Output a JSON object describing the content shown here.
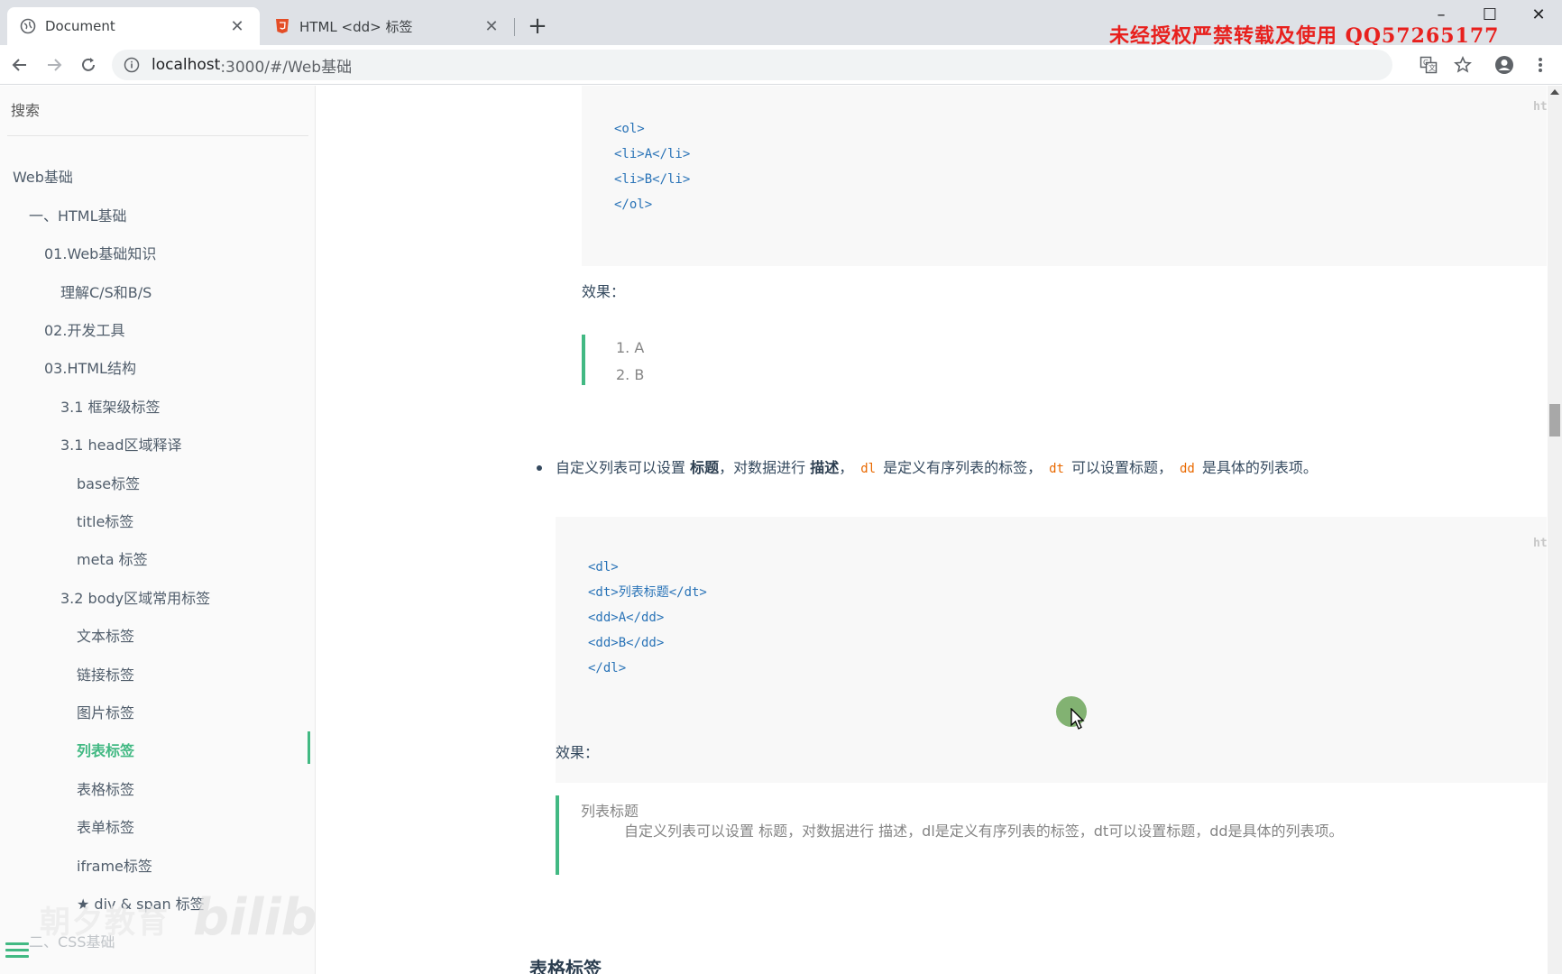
{
  "browser": {
    "tabs": [
      {
        "title": "Document",
        "active": true
      },
      {
        "title": "HTML <dd> 标签",
        "active": false
      }
    ],
    "url_host": "localhost",
    "url_path": ":3000/#/Web基础",
    "watermark": "未经授权严禁转载及使用 QQ57265177"
  },
  "sidebar": {
    "search_placeholder": "搜索",
    "items": [
      "Web基础",
      "一、HTML基础",
      "01.Web基础知识",
      "理解C/S和B/S",
      "02.开发工具",
      "03.HTML结构",
      "3.1 框架级标签",
      "3.1 head区域释译",
      "base标签",
      "title标签",
      "meta 标签",
      "3.2 body区域常用标签",
      "文本标签",
      "链接标签",
      "图片标签",
      "列表标签",
      "表格标签",
      "表单标签",
      "iframe标签",
      "★ div & span 标签",
      "二、CSS基础"
    ],
    "active_item": "列表标签",
    "brand_watermark": "朝夕教育",
    "site_watermark": "bilibili"
  },
  "content": {
    "code1": {
      "lang": "html",
      "lines": [
        "<ol>",
        "<li>A</li>",
        "<li>B</li>",
        "</ol>"
      ]
    },
    "effect_label_1": "效果：",
    "ol_items": [
      "1. A",
      "2. B"
    ],
    "bullet_text_parts": {
      "p1": "自定义列表可以设置 ",
      "b1": "标题",
      "p2": "，对数据进行 ",
      "b2": "描述",
      "p3": "，",
      "c1": "dl",
      "p4": "是定义有序列表的标签，",
      "c2": "dt",
      "p5": "可以设置标题，",
      "c3": "dd",
      "p6": "是具体的列表项。"
    },
    "code2": {
      "lang": "html",
      "lines": [
        "<dl>",
        "<dt>列表标题</dt>",
        "<dd>A</dd>",
        "<dd>B</dd>",
        "</dl>"
      ]
    },
    "effect_label_2": "效果：",
    "dl_title": "列表标题",
    "dl_desc": "自定义列表可以设置 标题，对数据进行 描述，dl是定义有序列表的标签，dt可以设置标题，dd是具体的列表项。",
    "next_heading": "表格标签"
  },
  "colors": {
    "accent": "#42b983",
    "code_text": "#2973b7",
    "inline_code": "#e96900",
    "watermark_red": "#e8201d"
  }
}
